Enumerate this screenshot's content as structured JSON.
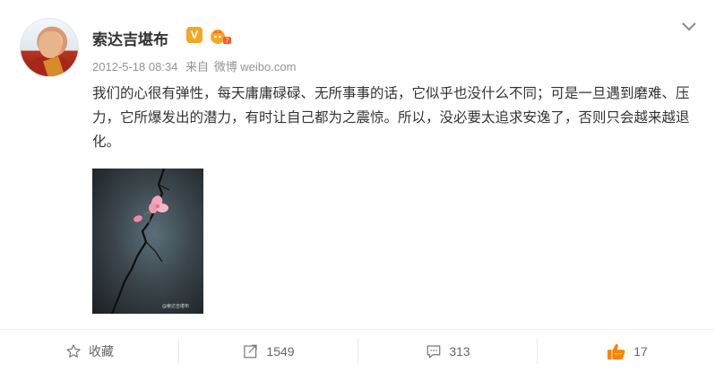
{
  "post": {
    "author": "索达吉堪布",
    "verified_badge": "V",
    "timestamp": "2012-5-18 08:34",
    "source_prefix": "来自",
    "source_app": "微博 weibo.com",
    "text": "我们的心很有弹性，每天庸庸碌碌、无所事事的话，它似乎也没什么不同；可是一旦遇到磨难、压力，它所爆发出的潜力，有时让自己都为之震惊。所以，没必要太追求安逸了，否则只会越来越退化。",
    "image_watermark": "@索达吉堪布",
    "colors": {
      "accent": "#f5a623",
      "like": "#ff8200",
      "muted": "#939393"
    }
  },
  "actions": {
    "favorite_label": "收藏",
    "repost_count": "1549",
    "comment_count": "313",
    "like_count": "17"
  },
  "icons": {
    "more": "chevron-down-icon",
    "favorite": "star-icon",
    "repost": "repost-icon",
    "comment": "comment-icon",
    "like": "thumbs-up-icon"
  }
}
